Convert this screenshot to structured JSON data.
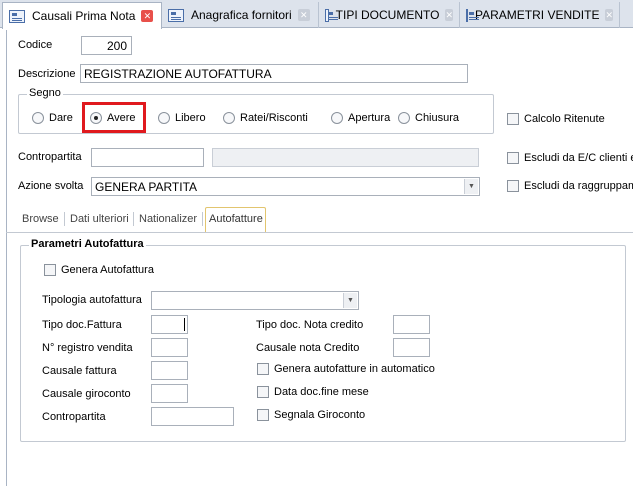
{
  "tabs": [
    {
      "label": "Causali Prima Nota",
      "active": true
    },
    {
      "label": "Anagrafica fornitori",
      "active": false
    },
    {
      "label": "TIPI DOCUMENTO",
      "active": false
    },
    {
      "label": "PARAMETRI VENDITE",
      "active": false
    }
  ],
  "form": {
    "codice_label": "Codice",
    "codice_value": "200",
    "descrizione_label": "Descrizione",
    "descrizione_value": "REGISTRAZIONE AUTOFATTURA",
    "segno_legend": "Segno",
    "segno_options": [
      "Dare",
      "Avere",
      "Libero",
      "Ratei/Risconti",
      "Apertura",
      "Chiusura"
    ],
    "segno_selected": "Avere",
    "calcolo_ritenute": "Calcolo Ritenute",
    "contropartita_label": "Contropartita",
    "contropartita_value": "",
    "contropartita_desc": "",
    "escludi_ec": "Escludi da E/C clienti e",
    "azione_label": "Azione svolta",
    "azione_value": "GENERA PARTITA",
    "escludi_raggr": "Escludi da raggruppame"
  },
  "subtabs": [
    "Browse",
    "Dati ulteriori",
    "Nationalizer",
    "Autofatture"
  ],
  "subtab_active": "Autofatture",
  "autofattura": {
    "legend": "Parametri Autofattura",
    "genera_autofattura": "Genera Autofattura",
    "tipologia_label": "Tipologia autofattura",
    "tipologia_value": "",
    "tipo_doc_fattura": "Tipo doc.Fattura",
    "tipo_doc_nota_credito": "Tipo doc. Nota credito",
    "n_registro_vendita": "N° registro vendita",
    "causale_nota_credito": "Causale nota Credito",
    "causale_fattura": "Causale fattura",
    "genera_automatico": "Genera autofatture in automatico",
    "causale_giroconto": "Causale giroconto",
    "data_doc_fine_mese": "Data doc.fine mese",
    "contropartita": "Contropartita",
    "segnala_giroconto": "Segnala Giroconto"
  }
}
